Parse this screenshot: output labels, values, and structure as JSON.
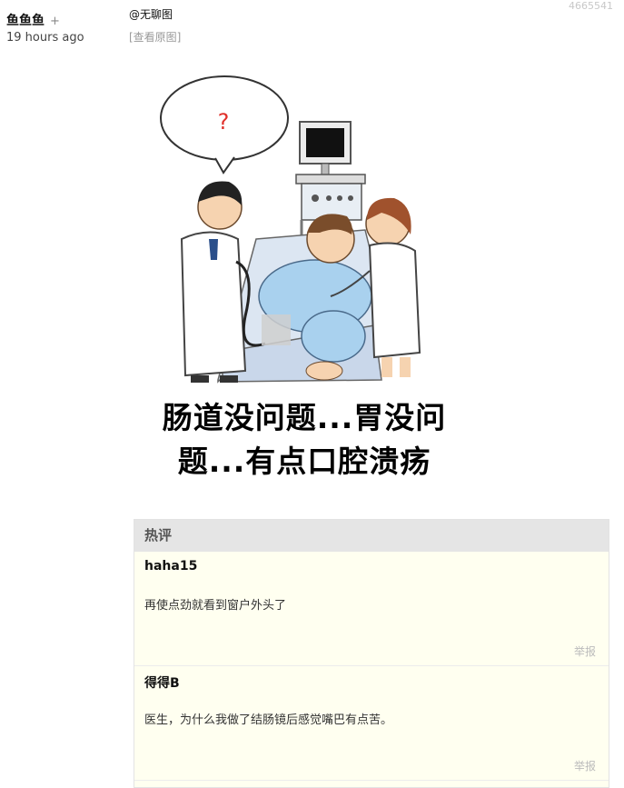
{
  "post": {
    "author": "鱼鱼鱼",
    "follow_symbol": "+",
    "time": "19 hours ago",
    "id": "4665541",
    "source": "@无聊图",
    "view_original": "[查看原图]"
  },
  "meme": {
    "bubble_text": "?",
    "caption_line1": "肠道没问题...胃没问",
    "caption_line2": "题...有点口腔溃疡"
  },
  "hot_comments": {
    "title": "热评",
    "items": [
      {
        "user": "haha15",
        "text": "再使点劲就看到窗户外头了",
        "report": "举报"
      },
      {
        "user": "得得B",
        "text": "医生，为什么我做了结肠镜后感觉嘴巴有点苦。",
        "report": "举报"
      }
    ]
  }
}
